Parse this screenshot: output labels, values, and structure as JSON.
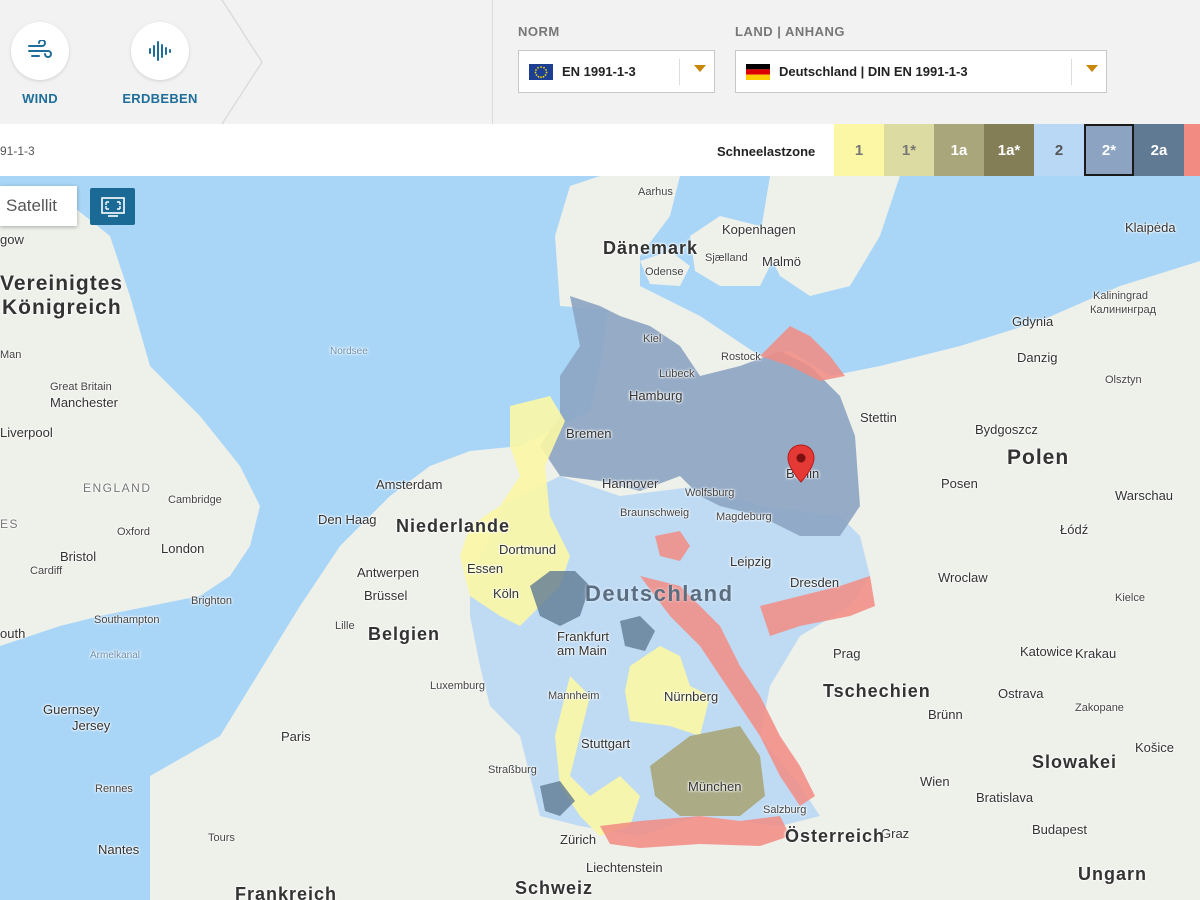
{
  "hazards": [
    {
      "label": "WIND",
      "icon": "wind-icon"
    },
    {
      "label": "ERDBEBEN",
      "icon": "earthquake-icon"
    }
  ],
  "selects": {
    "norm": {
      "label": "NORM",
      "value": "EN 1991-1-3",
      "flag": "eu-flag-icon"
    },
    "land": {
      "label": "LAND | ANHANG",
      "value": "Deutschland | DIN EN 1991-1-3",
      "flag": "germany-flag-icon"
    }
  },
  "legend": {
    "norm_tag": "91-1-3",
    "title": "Schneelastzone",
    "zones": [
      {
        "label": "1",
        "bg": "#fbf7a5",
        "fg": "#777",
        "active": false
      },
      {
        "label": "1*",
        "bg": "#dcdba1",
        "fg": "#777",
        "active": false
      },
      {
        "label": "1a",
        "bg": "#a8a67a",
        "fg": "#fff",
        "active": false
      },
      {
        "label": "1a*",
        "bg": "#847e57",
        "fg": "#fff",
        "active": false
      },
      {
        "label": "2",
        "bg": "#b9d8f5",
        "fg": "#555",
        "active": false
      },
      {
        "label": "2*",
        "bg": "#8ca4c2",
        "fg": "#fff",
        "active": true
      },
      {
        "label": "2a",
        "bg": "#607a94",
        "fg": "#fff",
        "active": false
      },
      {
        "label": "",
        "bg": "#f28b82",
        "fg": "#fff",
        "active": false
      }
    ]
  },
  "map": {
    "satellit_label": "Satellit",
    "main_label": "Deutschland",
    "labels": [
      {
        "text": "Dänemark",
        "cls": "country"
      },
      {
        "text": "Aarhus",
        "cls": "small"
      },
      {
        "text": "Kopenhagen",
        "cls": ""
      },
      {
        "text": "Malmö",
        "cls": ""
      },
      {
        "text": "Odense",
        "cls": "small"
      },
      {
        "text": "Sjælland",
        "cls": "small"
      },
      {
        "text": "Klaipėda",
        "cls": ""
      },
      {
        "text": "Kaliningrad",
        "cls": "small"
      },
      {
        "text": "Калининград",
        "cls": "small"
      },
      {
        "text": "Gdynia",
        "cls": ""
      },
      {
        "text": "Danzig",
        "cls": ""
      },
      {
        "text": "Olsztyn",
        "cls": "small"
      },
      {
        "text": "Stettin",
        "cls": ""
      },
      {
        "text": "Bydgoszcz",
        "cls": ""
      },
      {
        "text": "Polen",
        "cls": "bigcountry"
      },
      {
        "text": "Posen",
        "cls": ""
      },
      {
        "text": "Warschau",
        "cls": ""
      },
      {
        "text": "Łódź",
        "cls": ""
      },
      {
        "text": "Wroclaw",
        "cls": ""
      },
      {
        "text": "Kielce",
        "cls": "small"
      },
      {
        "text": "Katowice",
        "cls": ""
      },
      {
        "text": "Krakau",
        "cls": ""
      },
      {
        "text": "Ostrava",
        "cls": ""
      },
      {
        "text": "Zakopane",
        "cls": "small"
      },
      {
        "text": "Košice",
        "cls": ""
      },
      {
        "text": "Slowakei",
        "cls": "country"
      },
      {
        "text": "Prag",
        "cls": ""
      },
      {
        "text": "Tschechien",
        "cls": "country"
      },
      {
        "text": "Brünn",
        "cls": ""
      },
      {
        "text": "Wien",
        "cls": ""
      },
      {
        "text": "Bratislava",
        "cls": ""
      },
      {
        "text": "Budapest",
        "cls": ""
      },
      {
        "text": "Ungarn",
        "cls": "country"
      },
      {
        "text": "Graz",
        "cls": ""
      },
      {
        "text": "Österreich",
        "cls": "country"
      },
      {
        "text": "Salzburg",
        "cls": "small"
      },
      {
        "text": "München",
        "cls": ""
      },
      {
        "text": "Zürich",
        "cls": ""
      },
      {
        "text": "Schweiz",
        "cls": "country"
      },
      {
        "text": "Liechtenstein",
        "cls": ""
      },
      {
        "text": "Stuttgart",
        "cls": ""
      },
      {
        "text": "Straßburg",
        "cls": "small"
      },
      {
        "text": "Nürnberg",
        "cls": ""
      },
      {
        "text": "Mannheim",
        "cls": "small"
      },
      {
        "text": "Frankfurt",
        "cls": ""
      },
      {
        "text": "am Main",
        "cls": ""
      },
      {
        "text": "Leipzig",
        "cls": ""
      },
      {
        "text": "Dresden",
        "cls": ""
      },
      {
        "text": "Magdeburg",
        "cls": "small"
      },
      {
        "text": "Wolfsburg",
        "cls": "small"
      },
      {
        "text": "Braunschweig",
        "cls": "small"
      },
      {
        "text": "Hannover",
        "cls": ""
      },
      {
        "text": "Bremen",
        "cls": ""
      },
      {
        "text": "Hamburg",
        "cls": ""
      },
      {
        "text": "Lübeck",
        "cls": "small"
      },
      {
        "text": "Kiel",
        "cls": "small"
      },
      {
        "text": "Rostock",
        "cls": "small"
      },
      {
        "text": "Berlin",
        "cls": ""
      },
      {
        "text": "Dortmund",
        "cls": ""
      },
      {
        "text": "Essen",
        "cls": ""
      },
      {
        "text": "Köln",
        "cls": ""
      },
      {
        "text": "Amsterdam",
        "cls": ""
      },
      {
        "text": "Niederlande",
        "cls": "country"
      },
      {
        "text": "Den Haag",
        "cls": ""
      },
      {
        "text": "Antwerpen",
        "cls": ""
      },
      {
        "text": "Brüssel",
        "cls": ""
      },
      {
        "text": "Belgien",
        "cls": "country"
      },
      {
        "text": "Lille",
        "cls": "small"
      },
      {
        "text": "Luxemburg",
        "cls": "small"
      },
      {
        "text": "Paris",
        "cls": ""
      },
      {
        "text": "Rennes",
        "cls": "small"
      },
      {
        "text": "Tours",
        "cls": "small"
      },
      {
        "text": "Nantes",
        "cls": ""
      },
      {
        "text": "Frankreich",
        "cls": "country"
      },
      {
        "text": "Vereinigtes",
        "cls": "bigcountry"
      },
      {
        "text": "Königreich",
        "cls": "bigcountry"
      },
      {
        "text": "Man",
        "cls": "small"
      },
      {
        "text": "Great Britain",
        "cls": "small"
      },
      {
        "text": "Manchester",
        "cls": ""
      },
      {
        "text": "Liverpool",
        "cls": ""
      },
      {
        "text": "ENGLAND",
        "cls": "region"
      },
      {
        "text": "Cambridge",
        "cls": "small"
      },
      {
        "text": "Oxford",
        "cls": "small"
      },
      {
        "text": "London",
        "cls": ""
      },
      {
        "text": "Bristol",
        "cls": ""
      },
      {
        "text": "Cardiff",
        "cls": "small"
      },
      {
        "text": "Brighton",
        "cls": "small"
      },
      {
        "text": "Southampton",
        "cls": "small"
      },
      {
        "text": "Ärmelkanal",
        "cls": "sea"
      },
      {
        "text": "Guernsey",
        "cls": ""
      },
      {
        "text": "Jersey",
        "cls": ""
      },
      {
        "text": "gow",
        "cls": ""
      },
      {
        "text": "ES",
        "cls": "region"
      },
      {
        "text": "outh",
        "cls": ""
      },
      {
        "text": "Nordsee",
        "cls": "sea"
      }
    ]
  },
  "colors": {
    "sea": "#a9d6f7",
    "land": "#eef0ea",
    "accent": "#1f6e99",
    "pin": "#e53935"
  }
}
